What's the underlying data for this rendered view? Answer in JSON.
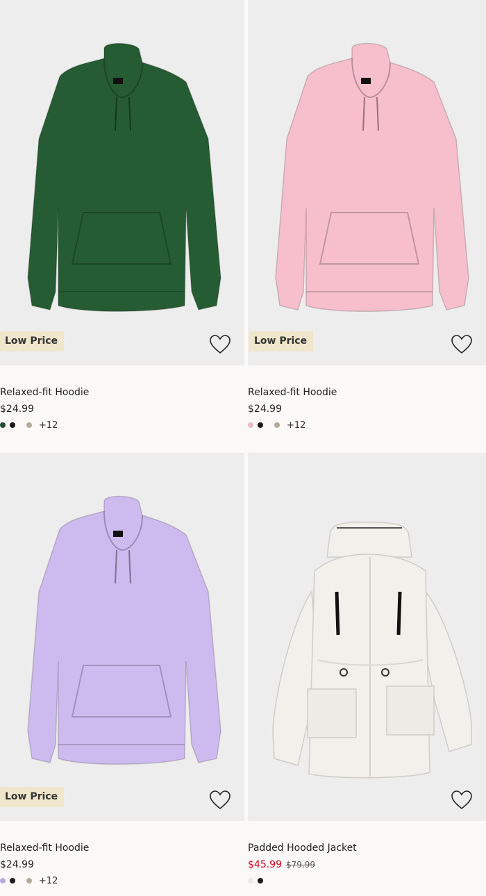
{
  "products": [
    {
      "name": "Relaxed-fit Hoodie",
      "price": "$24.99",
      "badge": "Low Price",
      "colors": [
        "#1f4a2e",
        "#1a1a1a",
        "#b5a998"
      ],
      "more_colors": "+12",
      "garment_color": "#255c33"
    },
    {
      "name": "Relaxed-fit Hoodie",
      "price": "$24.99",
      "badge": "Low Price",
      "colors": [
        "#e8b9cc",
        "#1a1a1a",
        "#b5a998"
      ],
      "more_colors": "+12",
      "garment_color": "#f7bfcc"
    },
    {
      "name": "Relaxed-fit Hoodie",
      "price": "$24.99",
      "badge": "Low Price",
      "colors": [
        "#b9a9e6",
        "#1a1a1a",
        "#b5a998"
      ],
      "more_colors": "+12",
      "garment_color": "#cdbbf0"
    },
    {
      "name": "Padded Hooded Jacket",
      "sale_price": "$45.99",
      "original_price": "$79.99",
      "colors": [
        "#ebe9e4",
        "#1a1a1a"
      ],
      "garment_color": "#f1f0ea"
    }
  ],
  "icons": {
    "favorite": "heart-outline-icon"
  }
}
